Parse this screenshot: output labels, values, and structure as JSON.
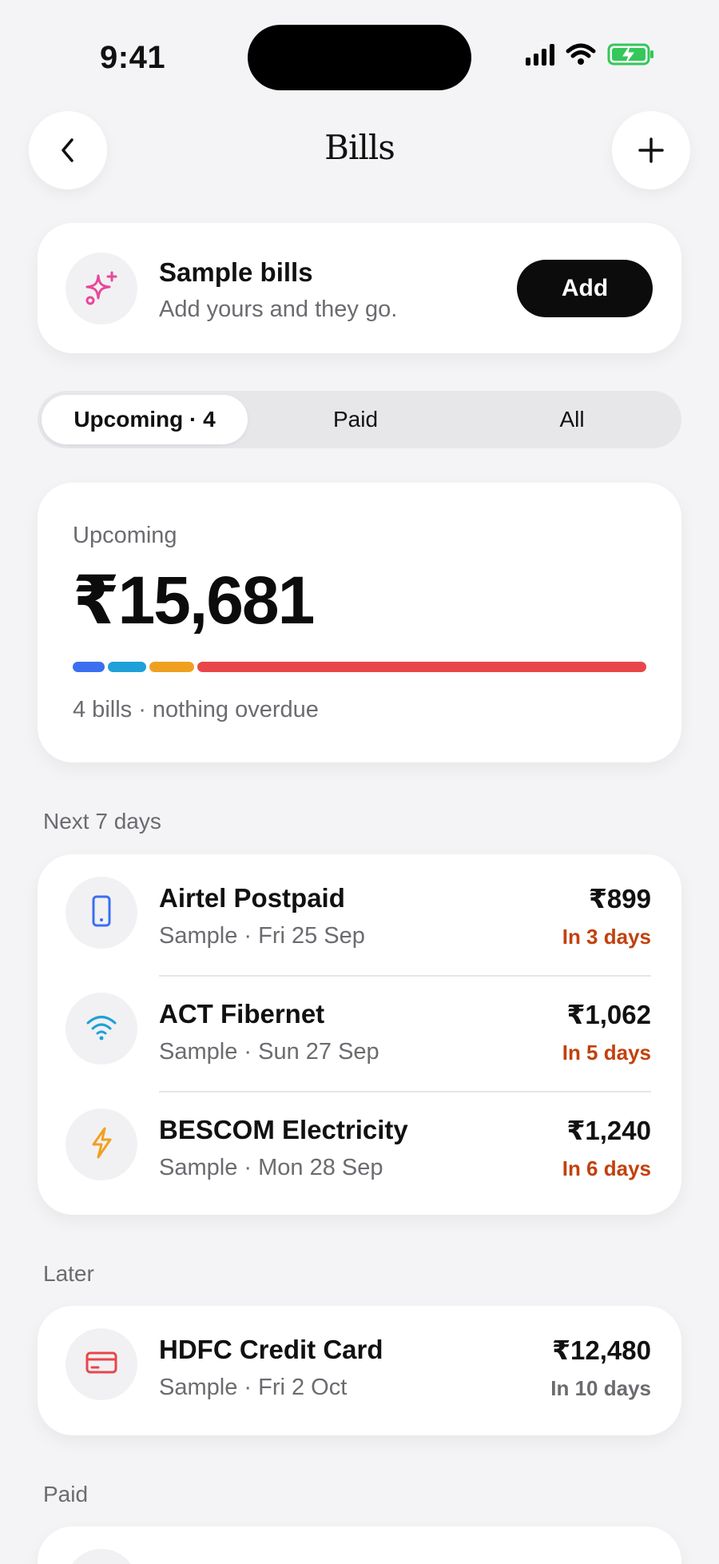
{
  "status_bar": {
    "time": "9:41"
  },
  "header": {
    "title": "Bills"
  },
  "sample_banner": {
    "title": "Sample bills",
    "subtitle": "Add yours and they go.",
    "add_label": "Add"
  },
  "tabs": [
    {
      "label": "Upcoming · 4",
      "active": true
    },
    {
      "label": "Paid",
      "active": false
    },
    {
      "label": "All",
      "active": false
    }
  ],
  "summary": {
    "label": "Upcoming",
    "amount": "₹15,681",
    "footnote": "4 bills · nothing overdue",
    "breakdown": [
      {
        "value": 899,
        "color": "#3b6ff0"
      },
      {
        "value": 1062,
        "color": "#1fa0d8"
      },
      {
        "value": 1240,
        "color": "#f0a020"
      },
      {
        "value": 12480,
        "color": "#e8464b"
      }
    ]
  },
  "sections": {
    "next7": "Next 7 days",
    "later": "Later",
    "paid": "Paid"
  },
  "bills_next7": [
    {
      "name": "Airtel Postpaid",
      "sub": "Sample · Fri 25 Sep",
      "amount": "₹899",
      "due": "In 3 days",
      "icon": "phone-icon",
      "icon_color": "#3b6ff0"
    },
    {
      "name": "ACT Fibernet",
      "sub": "Sample · Sun 27 Sep",
      "amount": "₹1,062",
      "due": "In 5 days",
      "icon": "wifi-icon",
      "icon_color": "#1fa0d8"
    },
    {
      "name": "BESCOM Electricity",
      "sub": "Sample · Mon 28 Sep",
      "amount": "₹1,240",
      "due": "In 6 days",
      "icon": "bolt-icon",
      "icon_color": "#f0a020"
    }
  ],
  "bills_later": [
    {
      "name": "HDFC Credit Card",
      "sub": "Sample · Fri 2 Oct",
      "amount": "₹12,480",
      "due": "In 10 days",
      "icon": "credit-card-icon",
      "icon_color": "#e8464b"
    }
  ],
  "colors": {
    "due_soon": "#c2410c",
    "due_later": "#6b6b70",
    "sparkle": "#e8489a"
  }
}
